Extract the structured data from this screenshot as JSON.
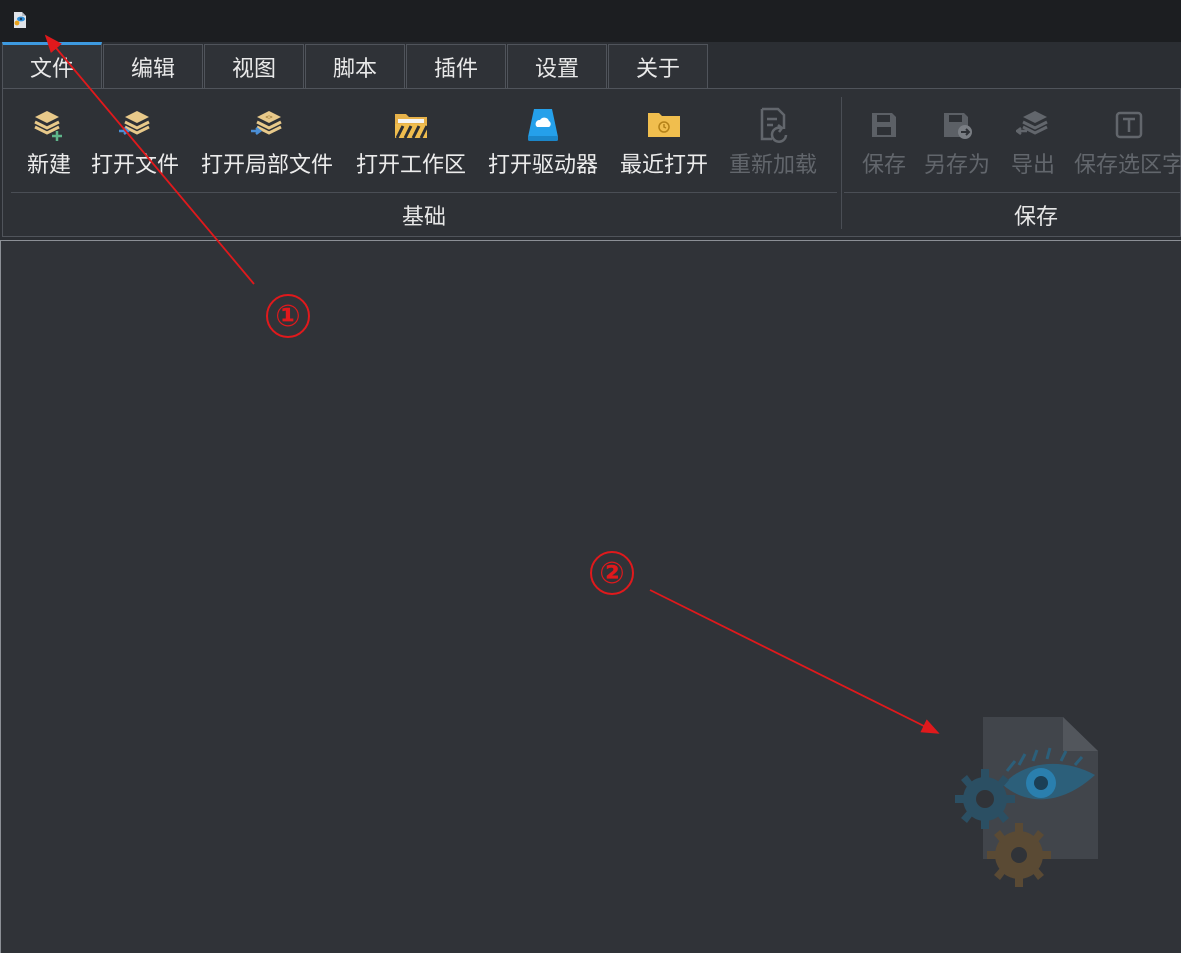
{
  "tabs": [
    {
      "label": "文件",
      "active": true
    },
    {
      "label": "编辑"
    },
    {
      "label": "视图"
    },
    {
      "label": "脚本"
    },
    {
      "label": "插件"
    },
    {
      "label": "设置"
    },
    {
      "label": "关于"
    }
  ],
  "ribbon": {
    "basic": {
      "label": "基础",
      "buttons": [
        {
          "label": "新建",
          "icon": "new-layers-icon"
        },
        {
          "label": "打开文件",
          "icon": "open-file-icon"
        },
        {
          "label": "打开局部文件",
          "icon": "open-partial-file-icon"
        },
        {
          "label": "打开工作区",
          "icon": "open-workspace-icon"
        },
        {
          "label": "打开驱动器",
          "icon": "open-drive-icon"
        },
        {
          "label": "最近打开",
          "icon": "recent-folder-icon"
        },
        {
          "label": "重新加载",
          "icon": "reload-icon",
          "disabled": true
        }
      ]
    },
    "save": {
      "label": "保存",
      "buttons": [
        {
          "label": "保存",
          "icon": "save-icon",
          "disabled": true
        },
        {
          "label": "另存为",
          "icon": "save-as-icon",
          "disabled": true
        },
        {
          "label": "导出",
          "icon": "export-icon",
          "disabled": true
        },
        {
          "label": "保存选区字",
          "icon": "save-selection-icon",
          "disabled": true
        }
      ]
    }
  },
  "annotations": {
    "callout1": "①",
    "callout2": "②",
    "color": "#e0191c"
  },
  "colors": {
    "accent": "#3d9ae0",
    "background": "#303338",
    "titlebar": "#1c1e21"
  }
}
